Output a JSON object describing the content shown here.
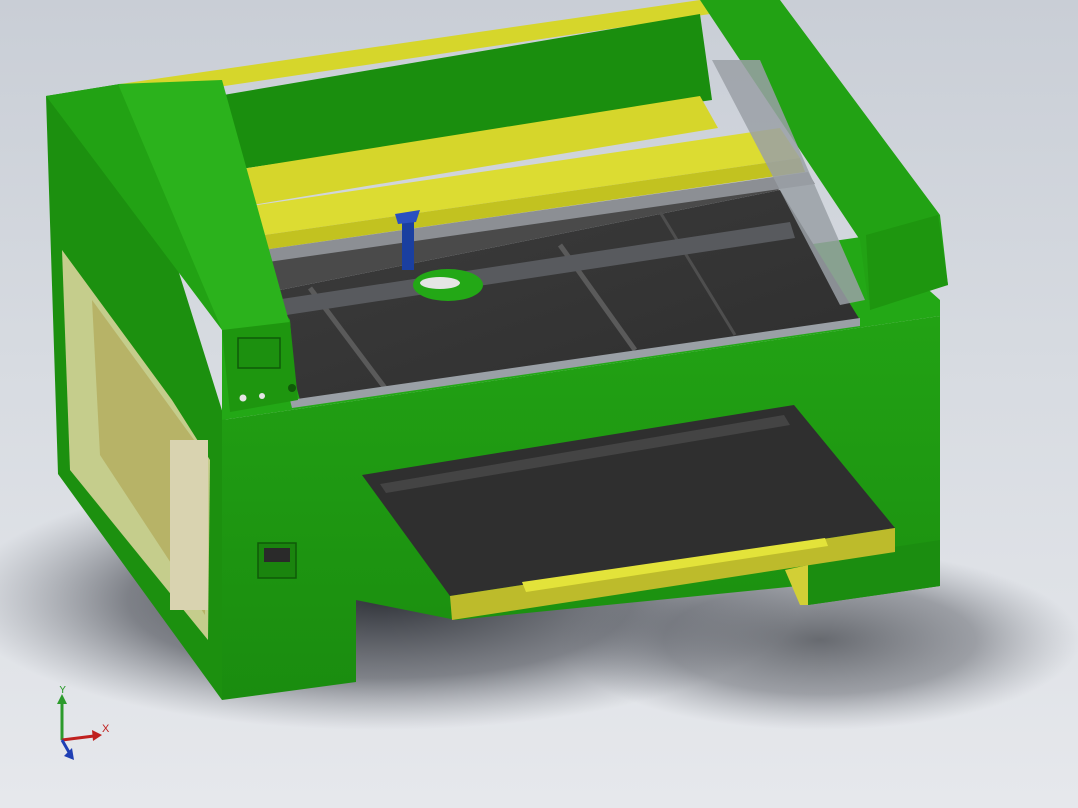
{
  "triad": {
    "x_label": "X",
    "y_label": "Y"
  },
  "colors": {
    "body_green": "#1f9a12",
    "body_green_dark": "#157a0b",
    "body_green_light": "#2cb01a",
    "rail_yellow": "#d6d62b",
    "rail_yellow_dark": "#b8b81d",
    "bed_dark": "#3a3a3a",
    "bed_darker": "#2b2b2b",
    "rail_gray": "#8c8f94",
    "laser_head_blue": "#1a3fa0",
    "glass_yellow": "#c9c47c",
    "axis_x": "#c0201e",
    "axis_y": "#2c9b2c",
    "axis_z": "#1f3fb4"
  }
}
